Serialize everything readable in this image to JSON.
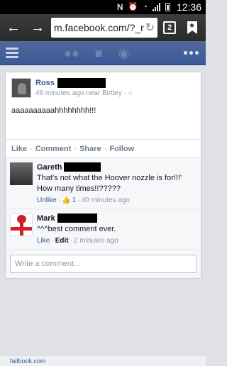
{
  "status_bar": {
    "time": "12:36"
  },
  "browser": {
    "url": "m.facebook.com/?_r",
    "tab_count": "2"
  },
  "post": {
    "author": "Ross",
    "meta": "46 minutes ago near Birtley · ",
    "text": "aaaaaaaaaahhhhhhhh!!!",
    "actions": {
      "like": "Like",
      "comment": "Comment",
      "share": "Share",
      "follow": "Follow"
    }
  },
  "comments": [
    {
      "name": "Gareth",
      "text": "That's not what the Hoover nozzle is for!!!' How many times!!?????",
      "action": "Unlike",
      "likes": "1",
      "time": "40 minutes ago"
    },
    {
      "name": "Mark",
      "text": "^^^best comment ever.",
      "action": "Like",
      "edit": "Edit",
      "time": "2 minutes ago"
    }
  ],
  "write_comment": {
    "placeholder": "Write a comment..."
  },
  "footer": {
    "text": "failbook.com"
  },
  "colors": {
    "facebook_blue": "#3b5998",
    "status_bar": "#000000"
  }
}
